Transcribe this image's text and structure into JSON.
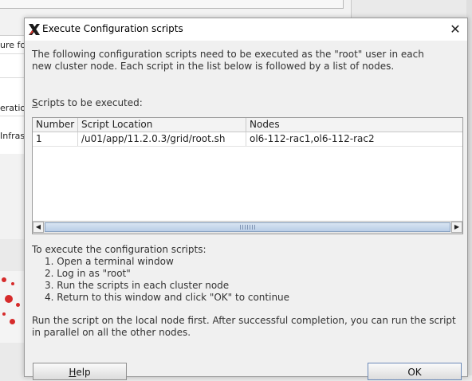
{
  "background": {
    "rows": [
      "ure fo",
      "eratio",
      "Infras"
    ]
  },
  "dialog": {
    "title": "Execute Configuration scripts",
    "icon": "x-logo-icon",
    "close_icon": "close-icon",
    "intro": "The following configuration scripts need to be executed as the \"root\" user in each new cluster node. Each script in the list below is followed by a list of nodes.",
    "scripts_label_mnemonic": "S",
    "scripts_label_rest": "cripts to be executed:",
    "table": {
      "columns": [
        "Number",
        "Script Location",
        "Nodes"
      ],
      "rows": [
        {
          "number": "1",
          "location": "/u01/app/11.2.0.3/grid/root.sh",
          "nodes": "ol6-112-rac1,ol6-112-rac2"
        }
      ]
    },
    "instructions_title": "To execute the configuration scripts:",
    "instructions": [
      "1. Open a terminal window",
      "2. Log in as \"root\"",
      "3. Run the scripts in each cluster node",
      "4. Return to this window and click \"OK\" to continue"
    ],
    "local_note": "Run the script on the local node first. After successful completion, you can run the script in parallel on all the other nodes.",
    "buttons": {
      "help_mnemonic": "H",
      "help_rest": "elp",
      "ok": "OK"
    }
  }
}
